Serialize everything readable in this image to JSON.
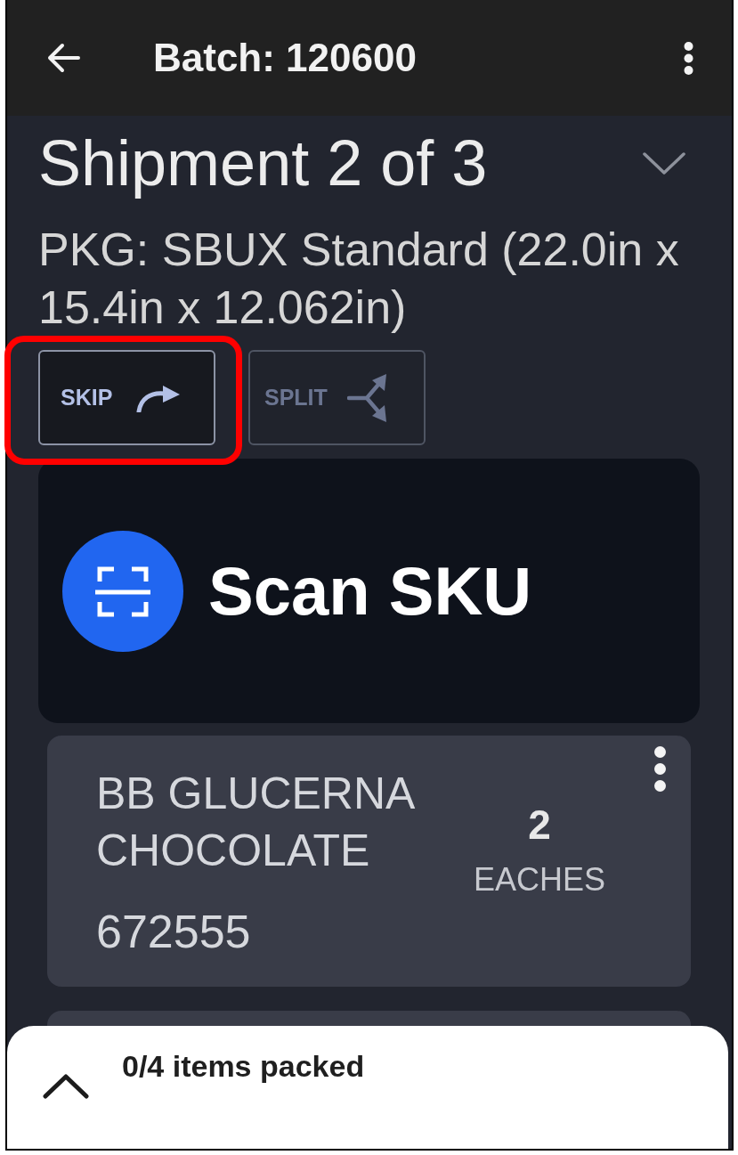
{
  "app_bar": {
    "title": "Batch: 120600"
  },
  "shipment": {
    "title": "Shipment 2 of 3",
    "expanded": false,
    "package": "PKG: SBUX Standard (22.0in x 15.4in x 12.062in)"
  },
  "actions": [
    {
      "kind": "skip",
      "label": "SKIP",
      "disabled": false,
      "highlighted": true
    },
    {
      "kind": "split",
      "label": "SPLIT",
      "disabled": true,
      "highlighted": false
    }
  ],
  "scan": {
    "label": "Scan SKU"
  },
  "items": [
    {
      "name": "BB GLUCERNA CHOCOLATE",
      "sku": "672555",
      "quantity": "2",
      "unit": "EACHES"
    }
  ],
  "bottom_sheet": {
    "summary": "0/4 items packed",
    "expanded": false
  }
}
